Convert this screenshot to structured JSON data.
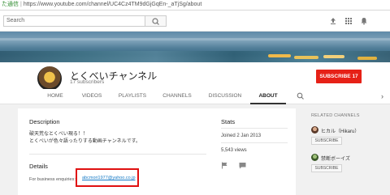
{
  "address_bar": {
    "secure_label": "た通信",
    "url": "https://www.youtube.com/channel/UC4Cz4TM9dGjGqEn-_aTjSg/about"
  },
  "masthead": {
    "search_placeholder": "Search"
  },
  "channel": {
    "name": "とくべいチャンネル",
    "subscribers": "17 subscribers",
    "subscribe_label": "SUBSCRIBE",
    "subscribe_count": "17"
  },
  "tabs": [
    {
      "label": "HOME"
    },
    {
      "label": "VIDEOS"
    },
    {
      "label": "PLAYLISTS"
    },
    {
      "label": "CHANNELS"
    },
    {
      "label": "DISCUSSION"
    },
    {
      "label": "ABOUT"
    }
  ],
  "about": {
    "description_title": "Description",
    "description_lines": [
      "破天荒なとくべい現る！！",
      "とくべいが色々語ったりする動画チャンネルです。"
    ],
    "details_title": "Details",
    "business_label": "For business enquiries:",
    "business_email": "abcmori1977@yahoo.co.jp"
  },
  "stats": {
    "title": "Stats",
    "joined": "Joined 2 Jan 2013",
    "views": "5,543 views"
  },
  "related": {
    "title": "RELATED CHANNELS",
    "channels": [
      {
        "name": "ヒカル（Hikaru）",
        "subscribe_label": "SUBSCRIBE"
      },
      {
        "name": "禁断ボーイズ",
        "subscribe_label": "SUBSCRIBE"
      }
    ]
  },
  "colors": {
    "subscribe_red": "#e62117",
    "link_blue": "#167ac6",
    "highlight_red": "#e01010"
  }
}
